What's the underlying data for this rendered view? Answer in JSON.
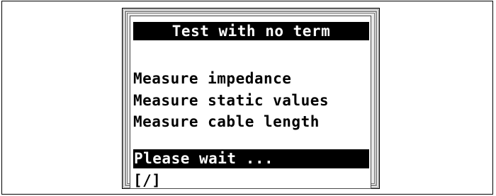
{
  "screen": {
    "title": "Test with no term",
    "menu_items": [
      "Measure impedance",
      "Measure static values",
      "Measure cable length"
    ],
    "status": "Please wait ...",
    "spinner": "[/]"
  },
  "colors": {
    "lcd_background": "#ffffff",
    "lcd_text": "#000000",
    "highlight_background": "#000000",
    "highlight_text": "#ffffff",
    "bezel": "#e8e8e8"
  }
}
